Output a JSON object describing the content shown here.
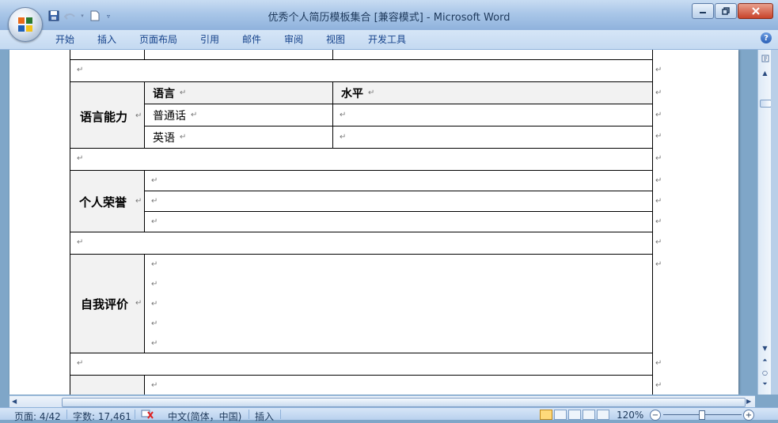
{
  "window": {
    "title": "优秀个人简历模板集合 [兼容模式] - Microsoft Word"
  },
  "ribbon": {
    "tabs": [
      "开始",
      "插入",
      "页面布局",
      "引用",
      "邮件",
      "审阅",
      "视图",
      "开发工具"
    ]
  },
  "document": {
    "para_mark": "↵",
    "language_section": {
      "label": "语言能力",
      "headers": [
        "语言",
        "水平"
      ],
      "rows": [
        {
          "language": "普通话",
          "level": ""
        },
        {
          "language": "英语",
          "level": ""
        }
      ]
    },
    "honors_section": {
      "label": "个人荣誉"
    },
    "self_eval_section": {
      "label": "自我评价"
    }
  },
  "statusbar": {
    "page": "页面: 4/42",
    "word_count": "字数: 17,461",
    "language": "中文(简体，中国)",
    "mode": "插入",
    "zoom": "120%"
  },
  "icons": [
    "office-button-icon",
    "save-icon",
    "undo-icon",
    "new-document-icon",
    "customize-qat-icon",
    "minimize-icon",
    "restore-icon",
    "close-icon",
    "help-icon",
    "scroll-up-icon",
    "scroll-down-icon",
    "prev-page-icon",
    "browse-object-icon",
    "next-page-icon",
    "proofing-error-icon",
    "zoom-out-icon",
    "zoom-in-icon"
  ]
}
